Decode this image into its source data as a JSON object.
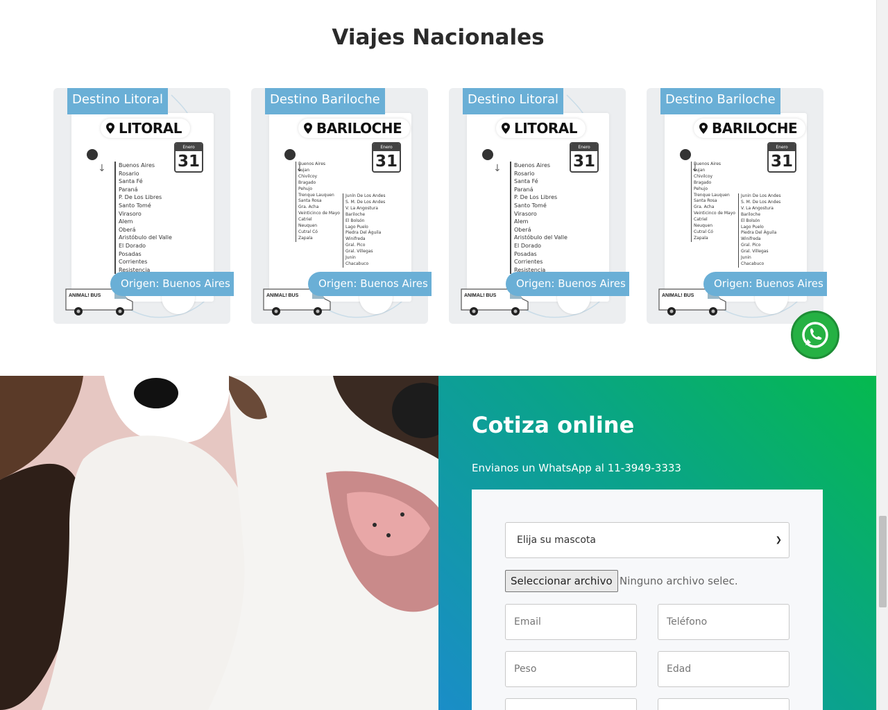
{
  "section": {
    "title": "Viajes Nacionales"
  },
  "cards": [
    {
      "dest_tag": "Destino Litoral",
      "place": "LITORAL",
      "month": "Enero",
      "day": "31",
      "stops": [
        "Buenos Aires",
        "Rosario",
        "Santa Fé",
        "Paraná",
        "P. De Los Libres",
        "Santo Tomé",
        "Virasoro",
        "Alem",
        "Oberá",
        "Aristóbulo del Valle",
        "El Dorado",
        "Posadas",
        "Corrientes",
        "Resistencia"
      ],
      "stops2": [],
      "origin": "Origen: Buenos Aires"
    },
    {
      "dest_tag": "Destino Bariloche",
      "place": "BARILOCHE",
      "month": "Enero",
      "day": "31",
      "stops": [
        "Buenos Aires",
        "Lujan",
        "Chivilcoy",
        "Bragado",
        "Pehujo",
        "Trenque Lauquen",
        "Santa Rosa",
        "Gra. Acha",
        "Veinticinco de Mayo",
        "Catriel",
        "Neuquen",
        "Cutral Có",
        "Zapala"
      ],
      "stops2": [
        "Junín De Los Andes",
        "S. M. De Los Andes",
        "V. La Angostura",
        "Bariloche",
        "El Bolsón",
        "Lago Puelo",
        "Piedra Del Águila",
        "Winifreda",
        "Gral. Pico",
        "Gral. Villegas",
        "Junin",
        "Chacabuco"
      ],
      "origin": "Origen: Buenos Aires"
    },
    {
      "dest_tag": "Destino Litoral",
      "place": "LITORAL",
      "month": "Enero",
      "day": "31",
      "stops": [
        "Buenos Aires",
        "Rosario",
        "Santa Fé",
        "Paraná",
        "P. De Los Libres",
        "Santo Tomé",
        "Virasoro",
        "Alem",
        "Oberá",
        "Aristóbulo del Valle",
        "El Dorado",
        "Posadas",
        "Corrientes",
        "Resistencia"
      ],
      "stops2": [],
      "origin": "Origen: Buenos Aires"
    },
    {
      "dest_tag": "Destino Bariloche",
      "place": "BARILOCHE",
      "month": "Enero",
      "day": "31",
      "stops": [
        "Buenos Aires",
        "Lujan",
        "Chivilcoy",
        "Bragado",
        "Pehujo",
        "Trenque Lauquen",
        "Santa Rosa",
        "Gra. Acha",
        "Veinticinco de Mayo",
        "Catriel",
        "Neuquen",
        "Cutral Có",
        "Zapala"
      ],
      "stops2": [
        "Junin De Los Andes",
        "S. M. De Los Andes",
        "V. La Angostura",
        "Bariloche",
        "El Bolsón",
        "Lago Puelo",
        "Piedra Del Águila",
        "Winifreda",
        "Gral. Pico",
        "Gral. Villegas",
        "Junin",
        "Chacabuco"
      ],
      "origin": "Origen: Buenos Aires"
    }
  ],
  "van_brand": "ANIMAL! BUS",
  "quote": {
    "title": "Cotiza online",
    "subtitle": "Envianos un WhatsApp al 11-3949-3333",
    "pet_select": "Elija su mascota",
    "file_button": "Seleccionar archivo",
    "file_name": "Ninguno archivo selec.",
    "email_placeholder": "Email",
    "phone_placeholder": "Teléfono",
    "weight_placeholder": "Peso",
    "age_placeholder": "Edad"
  },
  "icons": {
    "whatsapp": "whatsapp-icon",
    "messenger": "messenger-icon"
  },
  "colors": {
    "tag_blue": "#6aafd6",
    "quote_green": "#05b94e",
    "quote_blue": "#1a8dc8",
    "whatsapp_green": "#25b143"
  }
}
